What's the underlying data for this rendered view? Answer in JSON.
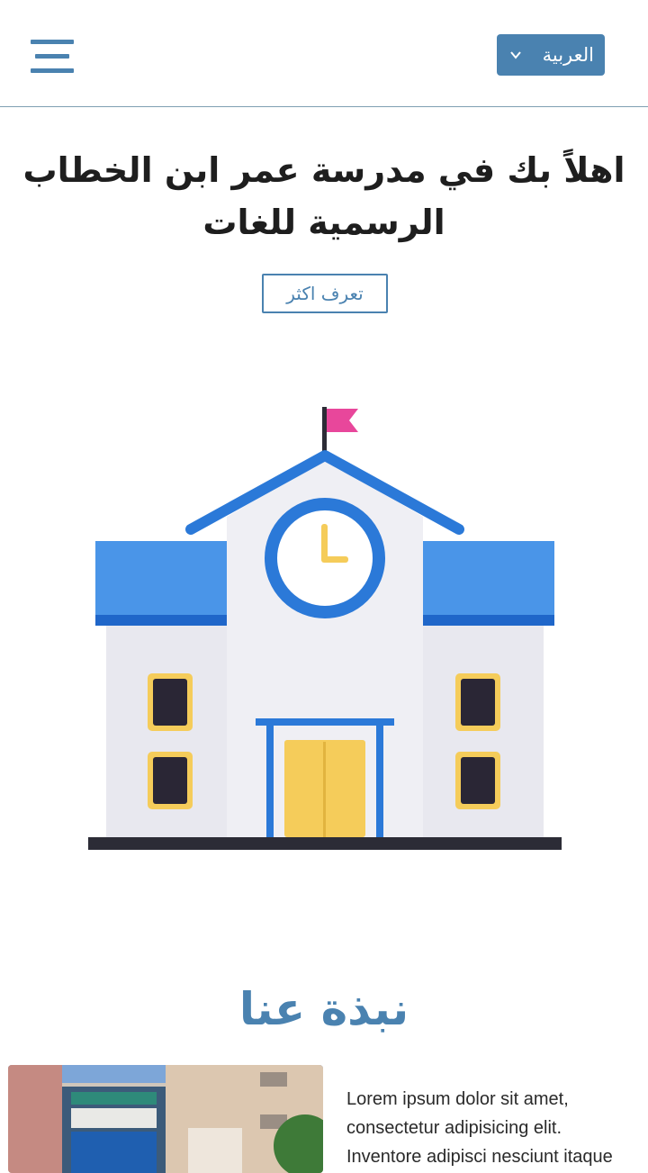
{
  "header": {
    "menu_icon": "hamburger-icon",
    "language": {
      "selected": "العربية",
      "icon": "chevron-down-icon"
    }
  },
  "hero": {
    "title": "اهلاً بك في مدرسة عمر ابن الخطاب الرسمية للغات",
    "cta_label": "تعرف اكثر",
    "illustration": "school-building-illustration"
  },
  "about": {
    "title": "نبذة عنا",
    "photo": "school-photo",
    "text": "Lorem ipsum dolor sit amet, consectetur adipisicing elit. Inventore adipisci nesciunt itaque"
  },
  "colors": {
    "accent": "#4a82b0",
    "roof_blue": "#3b87e0",
    "door_yellow": "#f5cc5a",
    "flag_pink": "#e8479b"
  }
}
